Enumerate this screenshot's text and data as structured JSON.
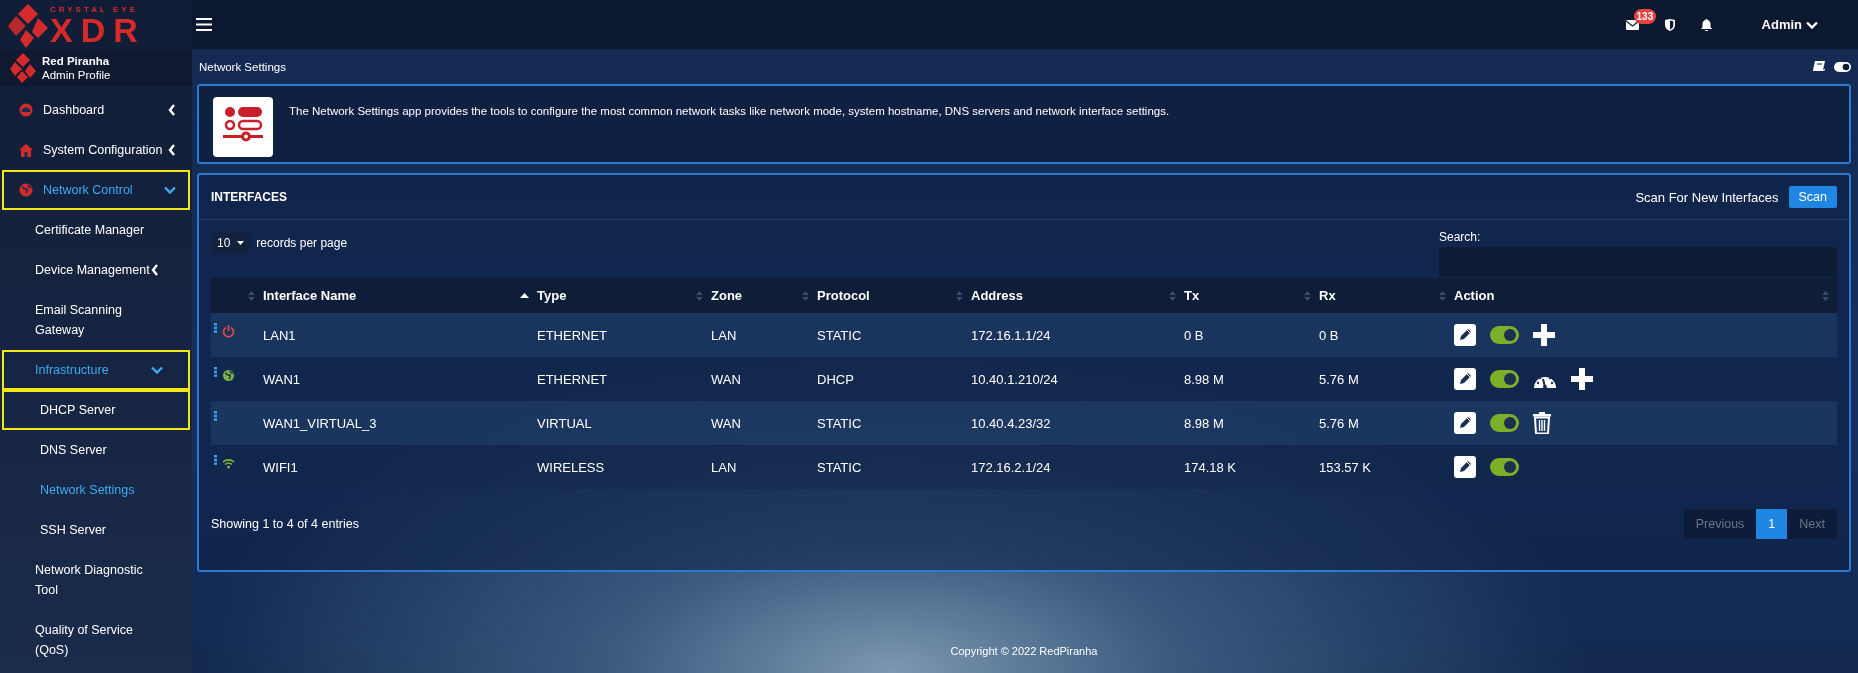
{
  "brand": {
    "tagline": "CRYSTAL EYE",
    "name": "XDR"
  },
  "profile": {
    "name": "Red Piranha",
    "role": "Admin Profile"
  },
  "sidebar": {
    "items": [
      {
        "label": "Dashboard",
        "expanded": false,
        "highlighted": false,
        "selected": false
      },
      {
        "label": "System Configuration",
        "expanded": false,
        "highlighted": false,
        "selected": false
      },
      {
        "label": "Network Control",
        "expanded": true,
        "highlighted": true,
        "selected": true,
        "children": [
          {
            "label": "Certificate Manager",
            "highlighted": false,
            "selected": false
          },
          {
            "label": "Device Management",
            "expanded": false,
            "highlighted": false,
            "selected": false
          },
          {
            "label": "Email Scanning Gateway",
            "highlighted": false,
            "selected": false
          },
          {
            "label": "Infrastructure",
            "expanded": true,
            "highlighted": true,
            "selected": true,
            "children": [
              {
                "label": "DHCP Server",
                "highlighted": true,
                "selected": false
              },
              {
                "label": "DNS Server",
                "highlighted": false,
                "selected": false
              },
              {
                "label": "Network Settings",
                "highlighted": false,
                "selected": true
              },
              {
                "label": "SSH Server",
                "highlighted": false,
                "selected": false
              }
            ]
          },
          {
            "label": "Network Diagnostic Tool",
            "highlighted": false,
            "selected": false
          },
          {
            "label": "Quality of Service (QoS)",
            "highlighted": false,
            "selected": false
          }
        ]
      }
    ]
  },
  "header": {
    "mail_badge": "133",
    "user": "Admin"
  },
  "page_title": "Network Settings",
  "info": {
    "text": "The Network Settings app provides the tools to configure the most common network tasks like network mode, system hostname, DNS servers and network interface settings."
  },
  "interfaces": {
    "title": "INTERFACES",
    "scan_label": "Scan For New Interfaces",
    "scan_button": "Scan",
    "page_size": "10",
    "page_size_label": "records per page",
    "search_label": "Search:",
    "columns": [
      {
        "sorted": false
      },
      {
        "label": "Interface Name",
        "sorted": true
      },
      {
        "label": "Type",
        "sorted": false
      },
      {
        "label": "Zone",
        "sorted": false
      },
      {
        "label": "Protocol",
        "sorted": false
      },
      {
        "label": "Address",
        "sorted": false
      },
      {
        "label": "Tx",
        "sorted": false
      },
      {
        "label": "Rx",
        "sorted": false
      },
      {
        "label": "Action",
        "sorted": false
      }
    ],
    "rows": [
      {
        "kind": "power",
        "name": "LAN1",
        "type": "ETHERNET",
        "zone": "LAN",
        "protocol": "STATIC",
        "address": "172.16.1.1/24",
        "tx": "0 B",
        "rx": "0 B",
        "actions": [
          {
            "kind": "edit"
          },
          {
            "kind": "toggle",
            "on": true
          },
          {
            "kind": "add"
          }
        ]
      },
      {
        "kind": "globe",
        "name": "WAN1",
        "type": "ETHERNET",
        "zone": "WAN",
        "protocol": "DHCP",
        "address": "10.40.1.210/24",
        "tx": "8.98 M",
        "rx": "5.76 M",
        "actions": [
          {
            "kind": "edit"
          },
          {
            "kind": "toggle",
            "on": true
          },
          {
            "kind": "gauge"
          },
          {
            "kind": "add"
          }
        ]
      },
      {
        "kind": "virtual",
        "name": "WAN1_VIRTUAL_3",
        "type": "VIRTUAL",
        "zone": "WAN",
        "protocol": "STATIC",
        "address": "10.40.4.23/32",
        "tx": "8.98 M",
        "rx": "5.76 M",
        "actions": [
          {
            "kind": "edit"
          },
          {
            "kind": "toggle",
            "on": true
          },
          {
            "kind": "delete"
          }
        ]
      },
      {
        "kind": "wifi",
        "name": "WIFI1",
        "type": "WIRELESS",
        "zone": "LAN",
        "protocol": "STATIC",
        "address": "172.16.2.1/24",
        "tx": "174.18 K",
        "rx": "153.57 K",
        "actions": [
          {
            "kind": "edit"
          },
          {
            "kind": "toggle",
            "on": true
          }
        ]
      }
    ],
    "summary": "Showing 1 to 4 of 4 entries",
    "pagination": [
      {
        "label": "Previous",
        "disabled": true,
        "selected": false
      },
      {
        "label": "1",
        "disabled": false,
        "selected": true
      },
      {
        "label": "Next",
        "disabled": true,
        "selected": false
      }
    ]
  },
  "footer": "Copyright © 2022 RedPiranha"
}
